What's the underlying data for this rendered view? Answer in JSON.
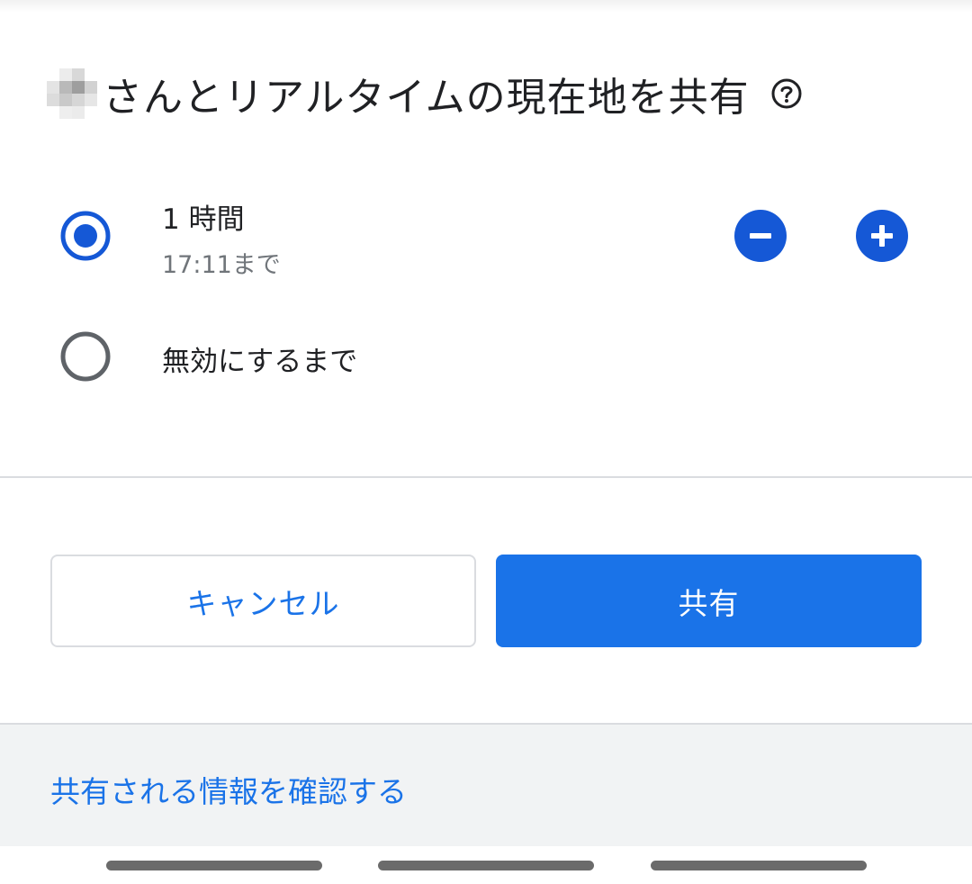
{
  "dialog": {
    "title": "さんとリアルタイムの現在地を共有",
    "help_icon": "help-circle-icon"
  },
  "options": [
    {
      "label": "1 時間",
      "sublabel": "17:11まで",
      "selected": true
    },
    {
      "label": "無効にするまで",
      "selected": false
    }
  ],
  "stepper": {
    "decrease_icon": "minus-circle-icon",
    "increase_icon": "plus-circle-icon"
  },
  "actions": {
    "cancel_label": "キャンセル",
    "share_label": "共有"
  },
  "footer": {
    "link_label": "共有される情報を確認する"
  },
  "colors": {
    "accent": "#1a73e8",
    "accent_dark": "#1558d6",
    "text_primary": "#202124",
    "text_secondary": "#70757a",
    "radio_unselected": "#5f6368",
    "footer_bg": "#f1f3f4"
  }
}
